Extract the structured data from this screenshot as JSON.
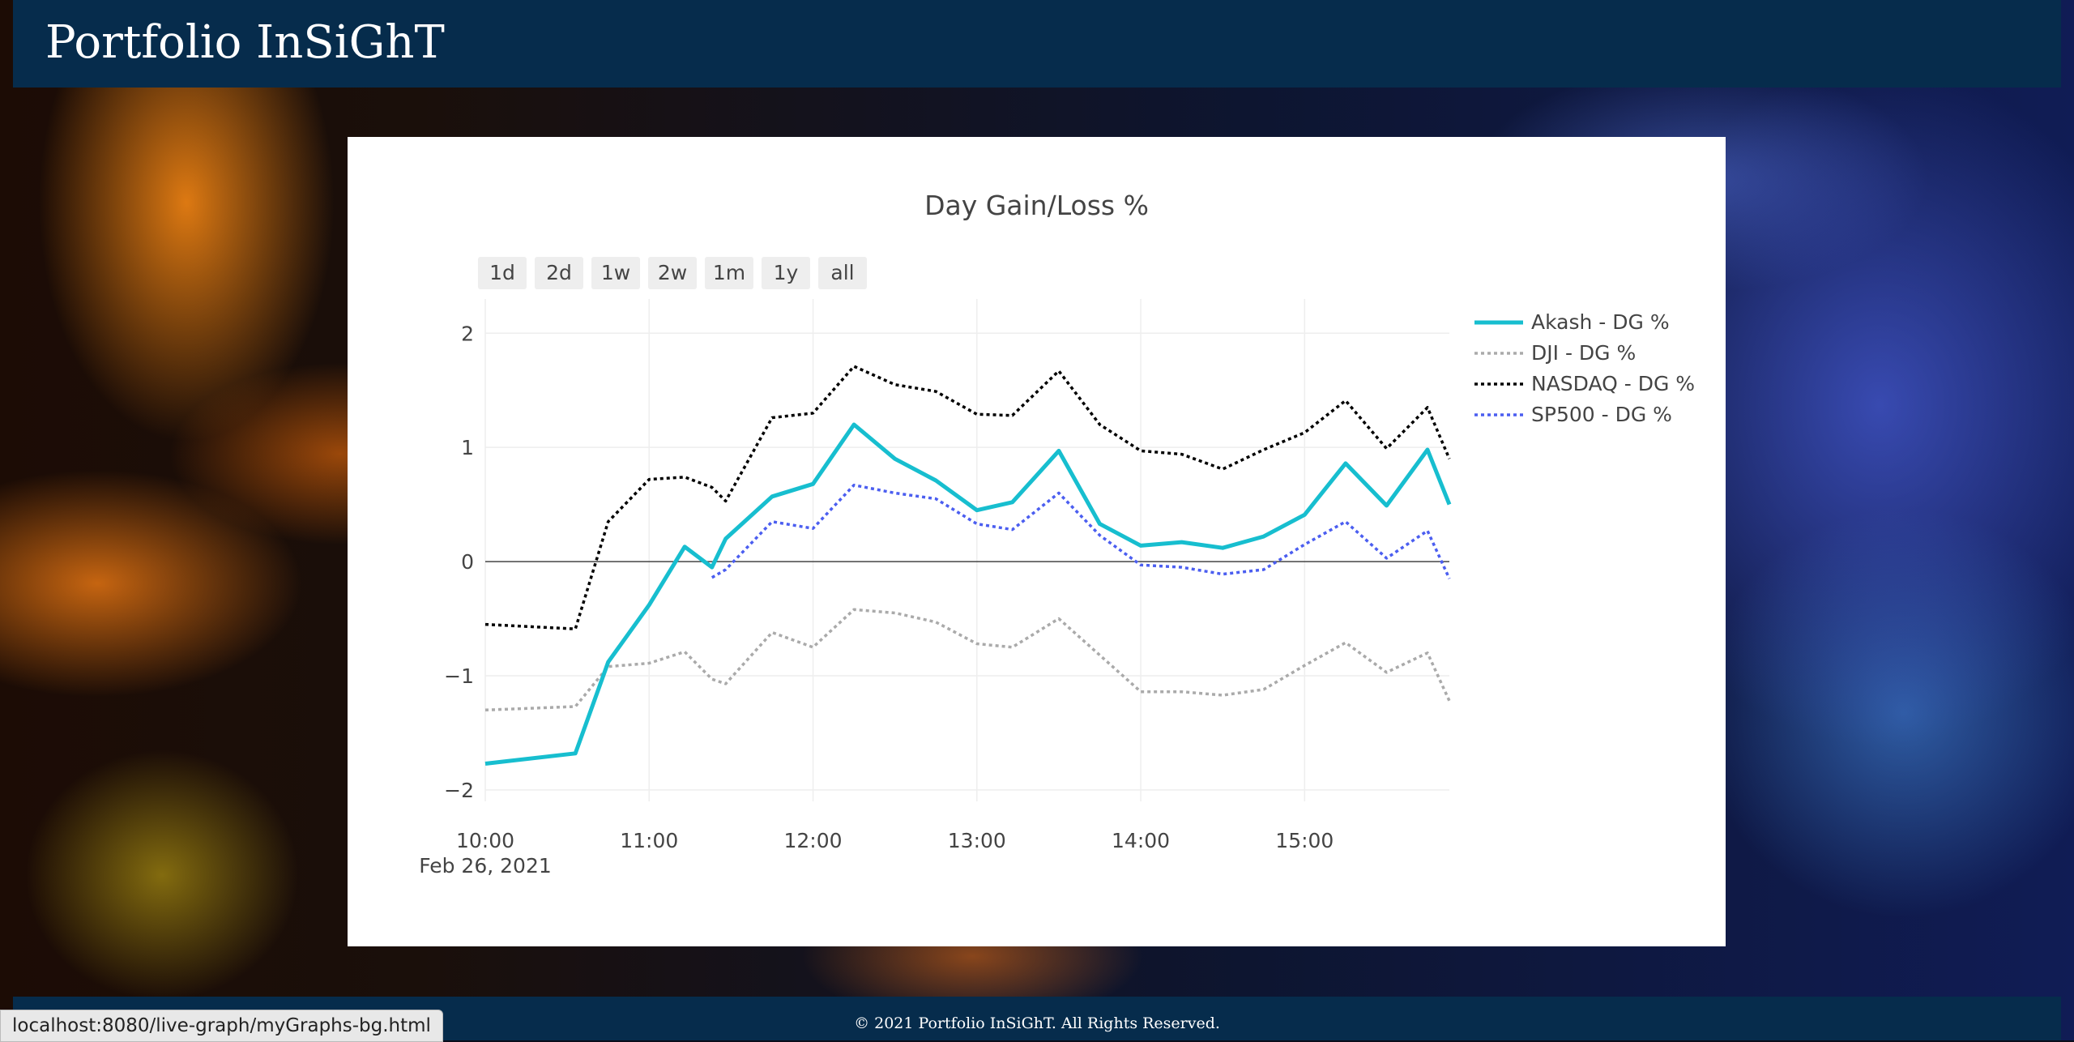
{
  "header": {
    "brand": "Portfolio InSiGhT"
  },
  "range_buttons": [
    "1d",
    "2d",
    "1w",
    "2w",
    "1m",
    "1y",
    "all"
  ],
  "footer": {
    "copyright": "© 2021 Portfolio InSiGhT. All Rights Reserved."
  },
  "status_bar": {
    "url": "localhost:8080/live-graph/myGraphs-bg.html"
  },
  "chart_data": {
    "type": "line",
    "title": "Day Gain/Loss %",
    "xlabel": "",
    "ylabel": "",
    "x_tick_labels": [
      "10:00",
      "11:00",
      "12:00",
      "13:00",
      "14:00",
      "15:00"
    ],
    "x_date_label": "Feb 26, 2021",
    "xlim": [
      "10:00",
      "15:53"
    ],
    "ylim": [
      -2.1,
      2.3
    ],
    "y_tick_values": [
      -2,
      -1,
      0,
      1,
      2
    ],
    "grid": true,
    "legend_position": "right",
    "series": [
      {
        "name": "Akash - DG %",
        "color": "#17becf",
        "dash": "solid",
        "points": [
          [
            "10:00",
            -1.77
          ],
          [
            "10:33",
            -1.68
          ],
          [
            "10:45",
            -0.88
          ],
          [
            "11:00",
            -0.38
          ],
          [
            "11:13",
            0.13
          ],
          [
            "11:23",
            -0.05
          ],
          [
            "11:28",
            0.2
          ],
          [
            "11:45",
            0.57
          ],
          [
            "12:00",
            0.68
          ],
          [
            "12:15",
            1.2
          ],
          [
            "12:30",
            0.9
          ],
          [
            "12:45",
            0.71
          ],
          [
            "13:00",
            0.45
          ],
          [
            "13:13",
            0.52
          ],
          [
            "13:30",
            0.97
          ],
          [
            "13:45",
            0.33
          ],
          [
            "14:00",
            0.14
          ],
          [
            "14:15",
            0.17
          ],
          [
            "14:30",
            0.12
          ],
          [
            "14:45",
            0.22
          ],
          [
            "15:00",
            0.41
          ],
          [
            "15:15",
            0.86
          ],
          [
            "15:30",
            0.49
          ],
          [
            "15:45",
            0.98
          ],
          [
            "15:53",
            0.5
          ]
        ]
      },
      {
        "name": "DJI - DG %",
        "color": "#aaaaaa",
        "dash": "dot",
        "points": [
          [
            "10:00",
            -1.3
          ],
          [
            "10:33",
            -1.27
          ],
          [
            "10:45",
            -0.92
          ],
          [
            "11:00",
            -0.89
          ],
          [
            "11:13",
            -0.79
          ],
          [
            "11:23",
            -1.03
          ],
          [
            "11:28",
            -1.07
          ],
          [
            "11:45",
            -0.62
          ],
          [
            "12:00",
            -0.75
          ],
          [
            "12:15",
            -0.42
          ],
          [
            "12:30",
            -0.45
          ],
          [
            "12:45",
            -0.53
          ],
          [
            "13:00",
            -0.72
          ],
          [
            "13:13",
            -0.75
          ],
          [
            "13:30",
            -0.5
          ],
          [
            "13:45",
            -0.82
          ],
          [
            "14:00",
            -1.14
          ],
          [
            "14:15",
            -1.14
          ],
          [
            "14:30",
            -1.17
          ],
          [
            "14:45",
            -1.12
          ],
          [
            "15:00",
            -0.91
          ],
          [
            "15:15",
            -0.71
          ],
          [
            "15:30",
            -0.97
          ],
          [
            "15:45",
            -0.8
          ],
          [
            "15:53",
            -1.22
          ]
        ]
      },
      {
        "name": "NASDAQ - DG %",
        "color": "#000000",
        "dash": "dot",
        "points": [
          [
            "10:00",
            -0.55
          ],
          [
            "10:33",
            -0.59
          ],
          [
            "10:45",
            0.35
          ],
          [
            "11:00",
            0.72
          ],
          [
            "11:13",
            0.74
          ],
          [
            "11:23",
            0.65
          ],
          [
            "11:28",
            0.53
          ],
          [
            "11:45",
            1.26
          ],
          [
            "12:00",
            1.3
          ],
          [
            "12:15",
            1.71
          ],
          [
            "12:30",
            1.55
          ],
          [
            "12:45",
            1.49
          ],
          [
            "13:00",
            1.29
          ],
          [
            "13:13",
            1.28
          ],
          [
            "13:30",
            1.67
          ],
          [
            "13:45",
            1.2
          ],
          [
            "14:00",
            0.97
          ],
          [
            "14:15",
            0.94
          ],
          [
            "14:30",
            0.81
          ],
          [
            "14:45",
            0.98
          ],
          [
            "15:00",
            1.13
          ],
          [
            "15:15",
            1.41
          ],
          [
            "15:30",
            0.99
          ],
          [
            "15:45",
            1.35
          ],
          [
            "15:53",
            0.9
          ]
        ]
      },
      {
        "name": "SP500 - DG %",
        "color": "#4b5ef0",
        "dash": "dot",
        "points": [
          [
            "11:23",
            -0.14
          ],
          [
            "11:28",
            -0.07
          ],
          [
            "11:45",
            0.35
          ],
          [
            "12:00",
            0.29
          ],
          [
            "12:15",
            0.67
          ],
          [
            "12:30",
            0.6
          ],
          [
            "12:45",
            0.55
          ],
          [
            "13:00",
            0.33
          ],
          [
            "13:13",
            0.28
          ],
          [
            "13:30",
            0.6
          ],
          [
            "13:45",
            0.23
          ],
          [
            "14:00",
            -0.03
          ],
          [
            "14:15",
            -0.05
          ],
          [
            "14:30",
            -0.11
          ],
          [
            "14:45",
            -0.07
          ],
          [
            "15:00",
            0.15
          ],
          [
            "15:15",
            0.35
          ],
          [
            "15:30",
            0.03
          ],
          [
            "15:45",
            0.27
          ],
          [
            "15:53",
            -0.15
          ]
        ]
      }
    ]
  }
}
